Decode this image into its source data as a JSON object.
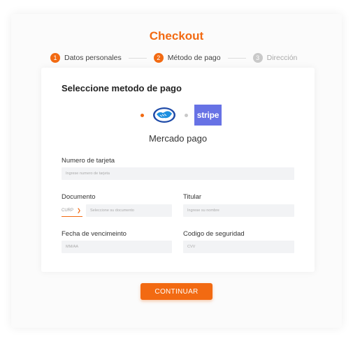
{
  "title": "Checkout",
  "steps": [
    {
      "number": "1",
      "label": "Datos personales",
      "state": "active"
    },
    {
      "number": "2",
      "label": "Método de pago",
      "state": "active"
    },
    {
      "number": "3",
      "label": "Dirección",
      "state": "inactive"
    }
  ],
  "payment": {
    "heading": "Seleccione metodo de pago",
    "selected_method": "Mercado pago",
    "stripe_label": "stripe",
    "options": [
      {
        "name": "mercado-pago",
        "icon": "handshake-icon",
        "selected": true
      },
      {
        "name": "stripe",
        "icon": "stripe-logo",
        "selected": false
      }
    ]
  },
  "fields": {
    "card_number": {
      "label": "Numero de tarjeta",
      "placeholder": "Ingrese numero de tarjeta"
    },
    "document": {
      "label": "Documento",
      "select_value": "CURP",
      "placeholder": "Seleccione su documento"
    },
    "holder": {
      "label": "Titular",
      "placeholder": "Ingrese su nombre"
    },
    "expiry": {
      "label": "Fecha de vencimeinto",
      "placeholder": "MM/AA"
    },
    "security_code": {
      "label": "Codigo de seguridad",
      "placeholder": "CVV"
    }
  },
  "continue_label": "CONTINUAR",
  "colors": {
    "accent": "#f26a12",
    "stripe": "#6772e5",
    "input_bg": "#f2f3f5"
  }
}
